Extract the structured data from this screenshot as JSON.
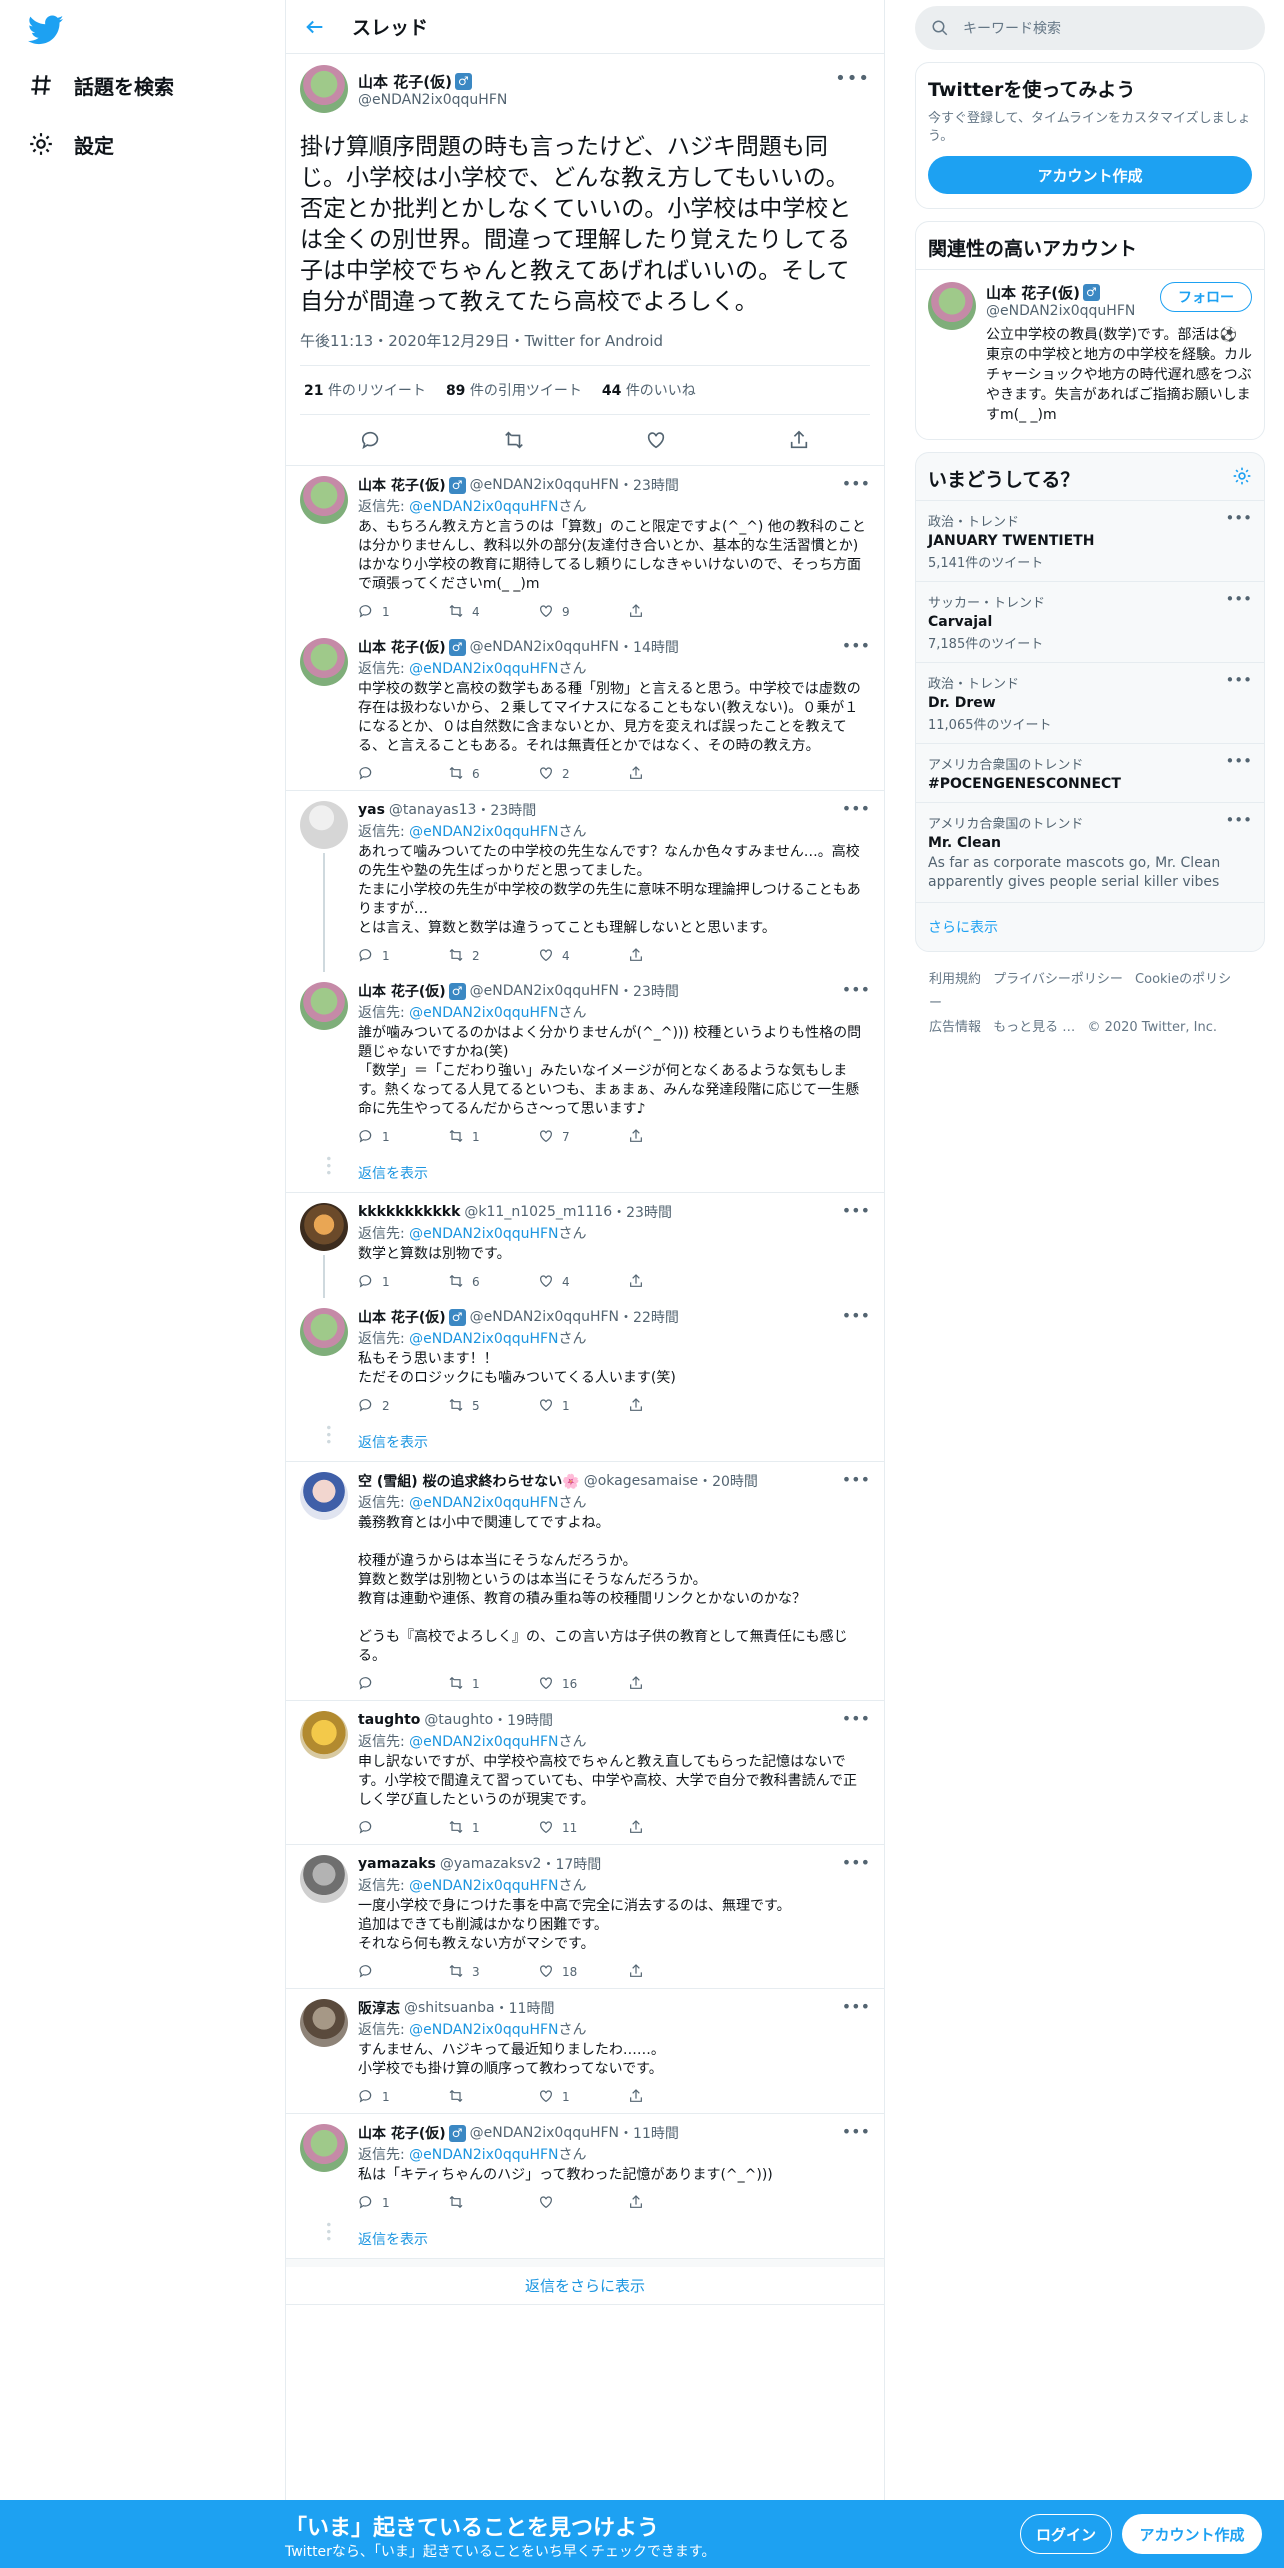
{
  "nav": {
    "explore": "話題を検索",
    "settings": "設定"
  },
  "header": {
    "title": "スレッド"
  },
  "focal": {
    "name": "山本 花子(仮)",
    "badge": "♂",
    "handle": "@eNDAN2ix0qquHFN",
    "text": "掛け算順序問題の時も言ったけど、ハジキ問題も同じ。小学校は小学校で、どんな教え方してもいいの。否定とか批判とかしなくていいの。小学校は中学校とは全くの別世界。間違って理解したり覚えたりしてる子は中学校でちゃんと教えてあげればいいの。そして自分が間違って教えてたら高校でよろしく。",
    "meta": "午後11:13・2020年12月29日・Twitter for Android",
    "retweets": "21",
    "retweets_label": "件のリツイート",
    "quotes": "89",
    "quotes_label": "件の引用ツイート",
    "likes": "44",
    "likes_label": "件のいいね"
  },
  "reply_prefix": "返信先: ",
  "reply_to": "@eNDAN2ix0qquHFN",
  "reply_suffix": "さん",
  "show_replies": "返信を表示",
  "replies": [
    {
      "name": "山本 花子(仮)",
      "badge": "♂",
      "handle": "@eNDAN2ix0qquHFN",
      "time": "・23時間",
      "text": "あ、もちろん教え方と言うのは「算数」のこと限定ですよ(^_^) 他の教科のことは分かりませんし、教科以外の部分(友達付き合いとか、基本的な生活習慣とか)はかなり小学校の教育に期待してるし頼りにしなきゃいけないので、そっち方面で頑張ってくださいm(_ _)m",
      "c": "1",
      "r": "4",
      "l": "9"
    },
    {
      "name": "山本 花子(仮)",
      "badge": "♂",
      "handle": "@eNDAN2ix0qquHFN",
      "time": "・14時間",
      "text": "中学校の数学と高校の数学もある種「別物」と言えると思う。中学校では虚数の存在は扱わないから、２乗してマイナスになることもない(教えない)。０乗が１になるとか、０は自然数に含まないとか、見方を変えれば誤ったことを教えてる、と言えることもある。それは無責任とかではなく、その時の教え方。",
      "c": "",
      "r": "6",
      "l": "2"
    },
    {
      "name": "yas",
      "badge": "",
      "handle": "@tanayas13",
      "time": "・23時間",
      "text": "あれって噛みついてたの中学校の先生なんです？なんか色々すみません…。高校の先生や塾の先生ばっかりだと思ってました。\nたまに小学校の先生が中学校の数学の先生に意味不明な理論押しつけることもありますが…\nとは言え、算数と数学は違うってことも理解しないとと思います。",
      "c": "1",
      "r": "2",
      "l": "4"
    },
    {
      "name": "山本 花子(仮)",
      "badge": "♂",
      "handle": "@eNDAN2ix0qquHFN",
      "time": "・23時間",
      "text": "誰が噛みついてるのかはよく分かりませんが(^_^))) 校種というよりも性格の問題じゃないですかね(笑)\n「数学」＝「こだわり強い」みたいなイメージが何となくあるような気もします。熱くなってる人見てるといつも、まぁまぁ、みんな発達段階に応じて一生懸命に先生やってるんだからさ～って思います♪",
      "c": "1",
      "r": "1",
      "l": "7"
    },
    {
      "name": "kkkkkkkkkkk",
      "badge": "",
      "handle": "@k11_n1025_m1116",
      "time": "・23時間",
      "text": "数学と算数は別物です。",
      "c": "1",
      "r": "6",
      "l": "4"
    },
    {
      "name": "山本 花子(仮)",
      "badge": "♂",
      "handle": "@eNDAN2ix0qquHFN",
      "time": "・22時間",
      "text": "私もそう思います！！\nただそのロジックにも噛みついてくる人います(笑)",
      "c": "2",
      "r": "5",
      "l": "1"
    },
    {
      "name": "空 (雪組) 桜の追求終わらせない🌸",
      "badge": "",
      "handle": "@okagesamaise",
      "time": "・20時間",
      "text": "義務教育とは小中で関連してですよね。\n\n校種が違うからは本当にそうなんだろうか。\n算数と数学は別物というのは本当にそうなんだろうか。\n教育は連動や連係、教育の積み重ね等の校種間リンクとかないのかな？\n\nどうも『高校でよろしく』の、この言い方は子供の教育として無責任にも感じる。",
      "c": "",
      "r": "1",
      "l": "16"
    },
    {
      "name": "taughto",
      "badge": "",
      "handle": "@taughto",
      "time": "・19時間",
      "text": "申し訳ないですが、中学校や高校でちゃんと教え直してもらった記憶はないです。小学校で間違えて習っていても、中学や高校、大学で自分で教科書読んで正しく学び直したというのが現実です。",
      "c": "",
      "r": "1",
      "l": "11"
    },
    {
      "name": "yamazaks",
      "badge": "",
      "handle": "@yamazaksv2",
      "time": "・17時間",
      "text": "一度小学校で身につけた事を中高で完全に消去するのは、無理です。\n追加はできても削減はかなり困難です。\nそれなら何も教えない方がマシです。",
      "c": "",
      "r": "3",
      "l": "18"
    },
    {
      "name": "阪淳志",
      "badge": "",
      "handle": "@shitsuanba",
      "time": "・11時間",
      "text": "すんません、ハジキって最近知りましたわ……。\n小学校でも掛け算の順序って教わってないです。",
      "c": "1",
      "r": "",
      "l": "1"
    },
    {
      "name": "山本 花子(仮)",
      "badge": "♂",
      "handle": "@eNDAN2ix0qquHFN",
      "time": "・11時間",
      "text": "私は「キティちゃんのハジ」って教わった記憶があります(^_^)))",
      "c": "1",
      "r": "",
      "l": ""
    }
  ],
  "more_replies": "返信をさらに表示",
  "search": {
    "placeholder": "キーワード検索"
  },
  "signup": {
    "title": "Twitterを使ってみよう",
    "sub": "今すぐ登録して、タイムラインをカスタマイズしましょう。",
    "button": "アカウント作成"
  },
  "related": {
    "title": "関連性の高いアカウント",
    "name": "山本 花子(仮)",
    "badge": "♂",
    "handle": "@eNDAN2ix0qquHFN",
    "follow": "フォロー",
    "bio": "公立中学校の教員(数学)です。部活は⚽ 東京の中学校と地方の中学校を経験。カルチャーショックや地方の時代遅れ感をつぶやきます。失言があればご指摘お願いしますm(_ _)m"
  },
  "trends": {
    "title": "いまどうしてる？",
    "items": [
      {
        "cat": "政治・トレンド",
        "name": "JANUARY TWENTIETH",
        "count": "5,141件のツイート",
        "desc": ""
      },
      {
        "cat": "サッカー・トレンド",
        "name": "Carvajal",
        "count": "7,185件のツイート",
        "desc": ""
      },
      {
        "cat": "政治・トレンド",
        "name": "Dr. Drew",
        "count": "11,065件のツイート",
        "desc": ""
      },
      {
        "cat": "アメリカ合衆国のトレンド",
        "name": "#POCENGENESCONNECT",
        "count": "",
        "desc": ""
      },
      {
        "cat": "アメリカ合衆国のトレンド",
        "name": "Mr. Clean",
        "count": "",
        "desc": "As far as corporate mascots go, Mr. Clean apparently gives people serial killer vibes"
      }
    ],
    "show_more": "さらに表示"
  },
  "footer": {
    "terms": "利用規約",
    "privacy": "プライバシーポリシー",
    "cookie": "Cookieのポリシー",
    "ads": "広告情報",
    "more": "もっと見る …",
    "copy": "© 2020 Twitter, Inc."
  },
  "bottom": {
    "title": "「いま」起きていることを見つけよう",
    "sub": "Twitterなら、「いま」起きていることをいち早くチェックできます。",
    "login": "ログイン",
    "signup": "アカウント作成"
  },
  "colors": {
    "accent": "#1da1f2",
    "link": "#1b95e0"
  }
}
